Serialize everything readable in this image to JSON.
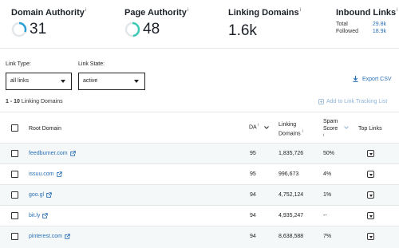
{
  "metrics": {
    "domain_authority": {
      "label": "Domain Authority",
      "info": "i",
      "value": "31",
      "progress": 0.31,
      "color": "#2a9fd6"
    },
    "page_authority": {
      "label": "Page Authority",
      "info": "i",
      "value": "48",
      "progress": 0.48,
      "color": "#3ec9b6"
    },
    "linking_domains": {
      "label": "Linking Domains",
      "info": "i",
      "value": "1.6k"
    },
    "inbound_links": {
      "label": "Inbound Links",
      "info": "i",
      "total_label": "Total",
      "total_value": "29.8k",
      "followed_label": "Followed",
      "followed_value": "18.9k"
    }
  },
  "filters": {
    "link_type": {
      "label": "Link Type:",
      "value": "all links"
    },
    "link_state": {
      "label": "Link State:",
      "value": "active"
    },
    "export_label": "Export CSV"
  },
  "results": {
    "range": "1 - 10",
    "label": "Linking Domains",
    "add_label": "Add to Link Tracking List"
  },
  "table": {
    "headers": {
      "root_domain": "Root Domain",
      "da": "DA",
      "da_info": "i",
      "linking_domains_line1": "Linking",
      "linking_domains_line2": "Domains",
      "linking_domains_info": "i",
      "spam_line1": "Spam",
      "spam_line2": "Score",
      "spam_info": "i",
      "top_links": "Top Links"
    },
    "rows": [
      {
        "domain": "feedburner.com",
        "da": "95",
        "linking_domains": "1,835,726",
        "spam": "50%"
      },
      {
        "domain": "issuu.com",
        "da": "95",
        "linking_domains": "996,673",
        "spam": "4%"
      },
      {
        "domain": "goo.gl",
        "da": "94",
        "linking_domains": "4,752,124",
        "spam": "1%"
      },
      {
        "domain": "bit.ly",
        "da": "94",
        "linking_domains": "4,935,247",
        "spam": "--"
      },
      {
        "domain": "pinterest.com",
        "da": "94",
        "linking_domains": "8,638,588",
        "spam": "7%"
      }
    ]
  },
  "colors": {
    "link": "#2a6fb5",
    "accent_blue": "#2a9fd6",
    "accent_teal": "#3ec9b6",
    "row_alt": "#f4f8f8"
  }
}
